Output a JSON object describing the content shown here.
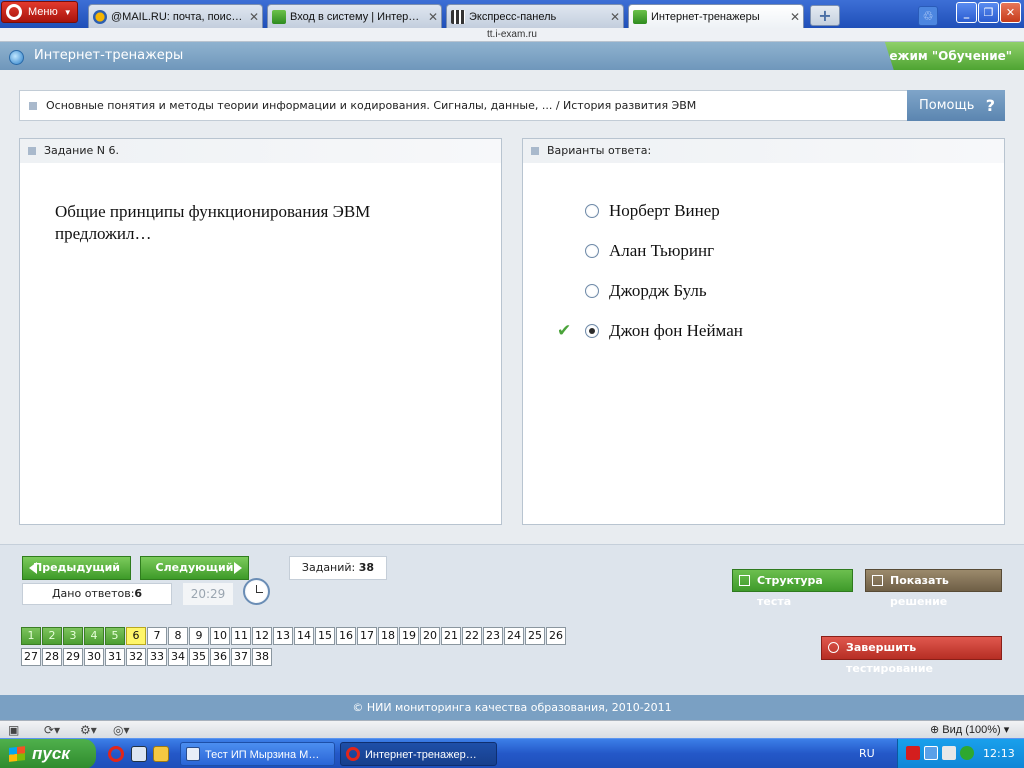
{
  "browser": {
    "menu_label": "Меню",
    "tabs": [
      {
        "label": "@MAIL.RU: почта, поис…"
      },
      {
        "label": "Вход в систему | Интер…"
      },
      {
        "label": "Экспресс-панель"
      },
      {
        "label": "Интернет-тренажеры"
      }
    ],
    "address": "tt.i-exam.ru"
  },
  "header": {
    "site_title": "Интернет-тренажеры",
    "mode": "режим \"Обучение\""
  },
  "breadcrumb": "Основные понятия и методы теории информации и кодирования. Сигналы, данные, ... / История развития ЭВМ",
  "help_label": "Помощь",
  "question": {
    "heading": "Задание N 6.",
    "text": "Общие принципы функционирования ЭВМ предложил…"
  },
  "answers": {
    "heading": "Варианты ответа:",
    "options": [
      {
        "label": "Норберт Винер",
        "checked": false
      },
      {
        "label": "Алан Тьюринг",
        "checked": false
      },
      {
        "label": "Джордж Буль",
        "checked": false
      },
      {
        "label": "Джон фон Нейман",
        "checked": true
      }
    ]
  },
  "navigation": {
    "prev_label": "Предыдущий",
    "next_label": "Следующий",
    "tasks_label": "Заданий:",
    "tasks_count": "38",
    "answered_label": "Дано ответов:",
    "answered_count": "6",
    "timer": "20:29",
    "structure_label": "Структура теста",
    "solution_label": "Показать решение",
    "finish_label": "Завершить тестирование",
    "question_numbers": [
      "1",
      "2",
      "3",
      "4",
      "5",
      "6",
      "7",
      "8",
      "9",
      "10",
      "11",
      "12",
      "13",
      "14",
      "15",
      "16",
      "17",
      "18",
      "19",
      "20",
      "21",
      "22",
      "23",
      "24",
      "25",
      "26",
      "27",
      "28",
      "29",
      "30",
      "31",
      "32",
      "33",
      "34",
      "35",
      "36",
      "37",
      "38"
    ],
    "answered_questions": 5,
    "current_question": 6
  },
  "footer": {
    "copyright": "© НИИ мониторинга качества образования, 2010-2011"
  },
  "statusbar": {
    "zoom": "Вид (100%)"
  },
  "taskbar": {
    "start_label": "пуск",
    "tasks": [
      {
        "label": "Тест ИП Мырзина М…"
      },
      {
        "label": "Интернет-тренажер…"
      }
    ],
    "language": "RU",
    "time": "12:13"
  },
  "colors": {
    "answered": "#4c9e32",
    "current": "#fff66a",
    "header": "#7aa0c3",
    "finish": "#b62e24"
  }
}
